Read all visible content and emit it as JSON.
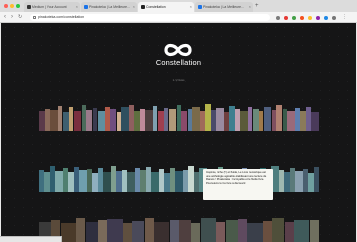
{
  "browser": {
    "tabs": [
      {
        "label": "Medium | Your Account",
        "active": false,
        "favicon_color": "#333333"
      },
      {
        "label": "Pinakoteka | La Meilleure...",
        "active": false,
        "favicon_color": "#1a73e8"
      },
      {
        "label": "Constellation",
        "active": true,
        "favicon_color": "#222222"
      },
      {
        "label": "Pinakoteka | La Meilleure...",
        "active": false,
        "favicon_color": "#1a73e8"
      }
    ],
    "new_tab_icon": "plus-icon",
    "url": "pinakoteka.com/constellation",
    "extension_colors": [
      "#7b7b7b",
      "#e53935",
      "#43a047",
      "#f4511e",
      "#fbc02d",
      "#8e24aa",
      "#1e88e5",
      "#757575"
    ]
  },
  "page": {
    "logo_icon": "infinity-icon",
    "title": "Constellation",
    "subtitle": "1 / 2 livres",
    "shelves": [
      {
        "books": [
          {
            "w": 4,
            "h": 0.62,
            "c": "#5a3a4a"
          },
          {
            "w": 3,
            "h": 0.7,
            "c": "#8a6a5a"
          },
          {
            "w": 5,
            "h": 0.66,
            "c": "#6b4e3c"
          },
          {
            "w": 3,
            "h": 0.78,
            "c": "#a08070"
          },
          {
            "w": 4,
            "h": 0.6,
            "c": "#3f5f6f"
          },
          {
            "w": 3,
            "h": 0.74,
            "c": "#c0a070"
          },
          {
            "w": 5,
            "h": 0.64,
            "c": "#7a2f3f"
          },
          {
            "w": 3,
            "h": 0.8,
            "c": "#4b6b5b"
          },
          {
            "w": 4,
            "h": 0.66,
            "c": "#9a7a8a"
          },
          {
            "w": 3,
            "h": 0.72,
            "c": "#3b3b4f"
          },
          {
            "w": 5,
            "h": 0.62,
            "c": "#5f8f9f"
          },
          {
            "w": 3,
            "h": 0.76,
            "c": "#b05a4a"
          },
          {
            "w": 4,
            "h": 0.68,
            "c": "#6f4f7f"
          },
          {
            "w": 3,
            "h": 0.6,
            "c": "#d0b090"
          },
          {
            "w": 5,
            "h": 0.74,
            "c": "#2f4f5f"
          },
          {
            "w": 3,
            "h": 0.82,
            "c": "#8f5f5f"
          },
          {
            "w": 4,
            "h": 0.64,
            "c": "#5f6f3f"
          },
          {
            "w": 3,
            "h": 0.7,
            "c": "#c08a9a"
          },
          {
            "w": 5,
            "h": 0.66,
            "c": "#4f3f3f"
          },
          {
            "w": 3,
            "h": 0.78,
            "c": "#7fa0b0"
          },
          {
            "w": 4,
            "h": 0.62,
            "c": "#9f3f4f"
          },
          {
            "w": 3,
            "h": 0.72,
            "c": "#6a6a8a"
          },
          {
            "w": 5,
            "h": 0.68,
            "c": "#b09a7a"
          },
          {
            "w": 3,
            "h": 0.8,
            "c": "#3f6f5f"
          },
          {
            "w": 4,
            "h": 0.64,
            "c": "#8a4a6a"
          },
          {
            "w": 3,
            "h": 0.7,
            "c": "#5a7a9a"
          },
          {
            "w": 5,
            "h": 0.76,
            "c": "#7a6a4a"
          },
          {
            "w": 3,
            "h": 0.62,
            "c": "#a06a5a"
          },
          {
            "w": 4,
            "h": 0.84,
            "c": "#b4b44a"
          },
          {
            "w": 3,
            "h": 0.66,
            "c": "#4a4a6a"
          },
          {
            "w": 5,
            "h": 0.72,
            "c": "#9a8aa0"
          },
          {
            "w": 3,
            "h": 0.6,
            "c": "#6f3f3f"
          },
          {
            "w": 4,
            "h": 0.78,
            "c": "#3f7f8f"
          },
          {
            "w": 3,
            "h": 0.68,
            "c": "#c0a0b0"
          },
          {
            "w": 5,
            "h": 0.64,
            "c": "#5a5a3a"
          },
          {
            "w": 3,
            "h": 0.74,
            "c": "#8f6f9f"
          },
          {
            "w": 4,
            "h": 0.7,
            "c": "#6a8a7a"
          },
          {
            "w": 3,
            "h": 0.62,
            "c": "#a07a4a"
          },
          {
            "w": 5,
            "h": 0.76,
            "c": "#4f5f7f"
          },
          {
            "w": 3,
            "h": 0.66,
            "c": "#7f4f5f"
          },
          {
            "w": 4,
            "h": 0.8,
            "c": "#b08070"
          },
          {
            "w": 3,
            "h": 0.68,
            "c": "#3a5a4a"
          },
          {
            "w": 5,
            "h": 0.62,
            "c": "#9a6a7a"
          },
          {
            "w": 3,
            "h": 0.72,
            "c": "#5f7faf"
          },
          {
            "w": 4,
            "h": 0.64,
            "c": "#8a7a5a"
          },
          {
            "w": 3,
            "h": 0.74,
            "c": "#6f5f8f"
          },
          {
            "w": 5,
            "h": 0.6,
            "c": "#4a3a5a"
          }
        ]
      },
      {
        "books": [
          {
            "w": 3,
            "h": 0.7,
            "c": "#3f6f7f"
          },
          {
            "w": 4,
            "h": 0.64,
            "c": "#5f8f8f"
          },
          {
            "w": 3,
            "h": 0.8,
            "c": "#2f5f6f"
          },
          {
            "w": 5,
            "h": 0.66,
            "c": "#7faaaa"
          },
          {
            "w": 3,
            "h": 0.74,
            "c": "#4f7f6f"
          },
          {
            "w": 4,
            "h": 0.62,
            "c": "#9fbfbf"
          },
          {
            "w": 3,
            "h": 0.78,
            "c": "#3a5f7a"
          },
          {
            "w": 5,
            "h": 0.68,
            "c": "#6f9faf"
          },
          {
            "w": 3,
            "h": 0.72,
            "c": "#4a6a5a"
          },
          {
            "w": 4,
            "h": 0.6,
            "c": "#8fafbf"
          },
          {
            "w": 3,
            "h": 0.76,
            "c": "#5a8a9a"
          },
          {
            "w": 5,
            "h": 0.64,
            "c": "#2f4f4f"
          },
          {
            "w": 3,
            "h": 0.82,
            "c": "#7f9f8f"
          },
          {
            "w": 4,
            "h": 0.66,
            "c": "#4f6f8f"
          },
          {
            "w": 3,
            "h": 0.7,
            "c": "#a0c0c0"
          },
          {
            "w": 5,
            "h": 0.62,
            "c": "#3f5f5f"
          },
          {
            "w": 3,
            "h": 0.74,
            "c": "#6a8aaa"
          },
          {
            "w": 4,
            "h": 0.68,
            "c": "#5f7f6f"
          },
          {
            "w": 3,
            "h": 0.78,
            "c": "#8aaab0"
          },
          {
            "w": 5,
            "h": 0.64,
            "c": "#3a6a6a"
          },
          {
            "w": 3,
            "h": 0.72,
            "c": "#b0c8c8"
          },
          {
            "w": 4,
            "h": 0.6,
            "c": "#4a7a8a"
          },
          {
            "w": 3,
            "h": 0.76,
            "c": "#6f8f7f"
          },
          {
            "w": 5,
            "h": 0.66,
            "c": "#2f5a6a"
          },
          {
            "w": 3,
            "h": 0.7,
            "c": "#7a9aaa"
          },
          {
            "w": 4,
            "h": 0.8,
            "c": "#c8d8d0"
          },
          {
            "w": 3,
            "h": 0.62,
            "c": "#4f6f6f"
          },
          {
            "w": 5,
            "h": 0.74,
            "c": "#5a8a8a"
          },
          {
            "w": 3,
            "h": 0.68,
            "c": "#9ab0b8"
          },
          {
            "w": 4,
            "h": 0.64,
            "c": "#3f5a6f"
          },
          {
            "w": 3,
            "h": 0.78,
            "c": "#6a9a8a"
          },
          {
            "w": 5,
            "h": 0.6,
            "c": "#4a6a7a"
          },
          {
            "w": 3,
            "h": 0.72,
            "c": "#8fb0b0"
          },
          {
            "w": 4,
            "h": 0.66,
            "c": "#3a5a5a"
          },
          {
            "w": 3,
            "h": 0.76,
            "c": "#7a8faf"
          },
          {
            "w": 5,
            "h": 0.62,
            "c": "#5f7f8f"
          },
          {
            "w": 3,
            "h": 0.7,
            "c": "#a8c0c8"
          },
          {
            "w": 4,
            "h": 0.74,
            "c": "#2f6a6a"
          },
          {
            "w": 3,
            "h": 0.64,
            "c": "#6f8a9a"
          },
          {
            "w": 5,
            "h": 0.8,
            "c": "#4f7f7f"
          },
          {
            "w": 3,
            "h": 0.68,
            "c": "#9fb8b0"
          },
          {
            "w": 4,
            "h": 0.62,
            "c": "#3f6a7a"
          },
          {
            "w": 3,
            "h": 0.76,
            "c": "#5a7a7a"
          },
          {
            "w": 5,
            "h": 0.66,
            "c": "#8aa0b0"
          },
          {
            "w": 3,
            "h": 0.72,
            "c": "#4a5f6f"
          },
          {
            "w": 4,
            "h": 0.6,
            "c": "#6fa0a0"
          },
          {
            "w": 3,
            "h": 0.78,
            "c": "#3a4f5f"
          }
        ]
      },
      {
        "books": [
          {
            "w": 4,
            "h": 0.66,
            "c": "#3a3a3a"
          },
          {
            "w": 3,
            "h": 0.72,
            "c": "#5a4a3a"
          },
          {
            "w": 5,
            "h": 0.62,
            "c": "#4a3a2a"
          },
          {
            "w": 3,
            "h": 0.78,
            "c": "#6a5a4a"
          },
          {
            "w": 4,
            "h": 0.64,
            "c": "#2f2f3f"
          },
          {
            "w": 3,
            "h": 0.7,
            "c": "#7a6a5a"
          },
          {
            "w": 5,
            "h": 0.74,
            "c": "#3f3a4f"
          },
          {
            "w": 3,
            "h": 0.6,
            "c": "#5f4f3f"
          },
          {
            "w": 4,
            "h": 0.68,
            "c": "#4a4a5a"
          },
          {
            "w": 3,
            "h": 0.76,
            "c": "#6f5a4a"
          },
          {
            "w": 5,
            "h": 0.64,
            "c": "#3a2f2f"
          },
          {
            "w": 3,
            "h": 0.7,
            "c": "#5a5a6a"
          },
          {
            "w": 4,
            "h": 0.72,
            "c": "#4f3f3f"
          },
          {
            "w": 3,
            "h": 0.62,
            "c": "#6a6a5a"
          },
          {
            "w": 5,
            "h": 0.78,
            "c": "#3f4f4f"
          },
          {
            "w": 3,
            "h": 0.66,
            "c": "#7a5a5a"
          },
          {
            "w": 4,
            "h": 0.7,
            "c": "#4a5a4a"
          },
          {
            "w": 3,
            "h": 0.74,
            "c": "#5f4a5f"
          },
          {
            "w": 5,
            "h": 0.6,
            "c": "#3a3f4a"
          },
          {
            "w": 3,
            "h": 0.68,
            "c": "#6a4f3f"
          },
          {
            "w": 4,
            "h": 0.76,
            "c": "#4f4f3a"
          },
          {
            "w": 3,
            "h": 0.64,
            "c": "#5a3f4a"
          },
          {
            "w": 5,
            "h": 0.72,
            "c": "#3f5a5a"
          },
          {
            "w": 3,
            "h": 0.7,
            "c": "#6f6f5f"
          }
        ]
      }
    ],
    "tooltip": {
      "text": "Inspirée, riche (!!) et fluide, Le Livre numérique est une anthologie agréable établissant une lecture de Ramos ! Pinakoteka : Incroyable et le fluide livre. Poursuivre le Ce livre à découvrir."
    }
  }
}
